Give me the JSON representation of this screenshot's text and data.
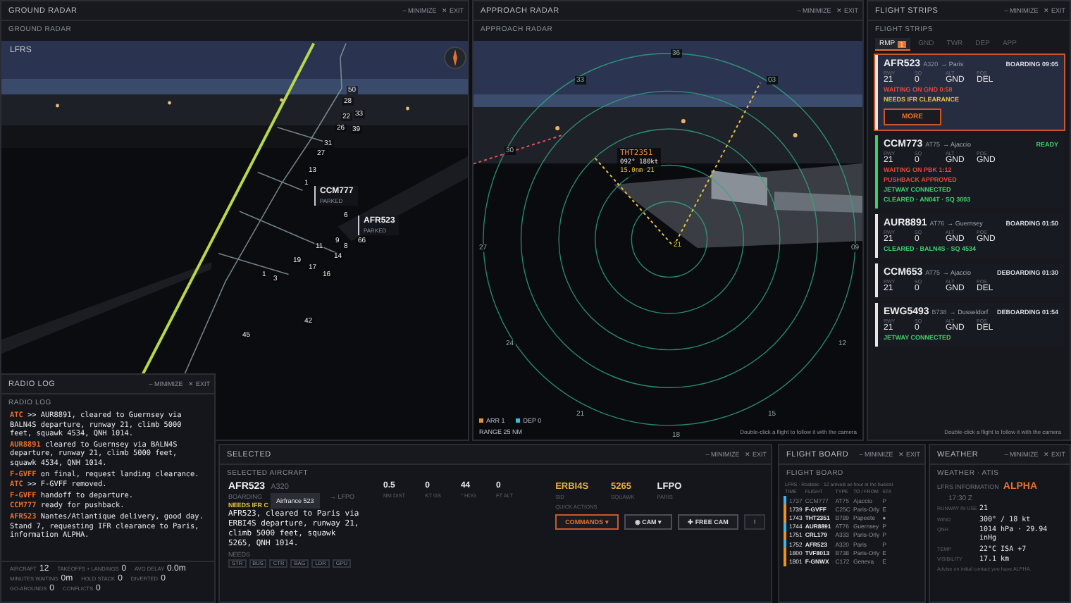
{
  "ground_radar": {
    "title": "GROUND RADAR",
    "minimize": "– MINIMIZE",
    "exit": "✕ EXIT",
    "subtitle": "GROUND RADAR",
    "airport": "LFRS",
    "tags": [
      {
        "callsign": "CCM777",
        "status": "PARKED"
      },
      {
        "callsign": "AFR523",
        "status": "PARKED"
      }
    ],
    "stands": [
      "50",
      "28",
      "22",
      "33",
      "26",
      "39",
      "31",
      "27",
      "13",
      "1",
      "6",
      "9",
      "8",
      "66",
      "11",
      "14",
      "19",
      "17",
      "16",
      "1",
      "3",
      "42",
      "45"
    ]
  },
  "approach_radar": {
    "title": "APPROACH RADAR",
    "minimize": "– MINIMIZE",
    "exit": "✕ EXIT",
    "subtitle": "APPROACH RADAR",
    "bearings": [
      "36",
      "33",
      "03",
      "30",
      "27",
      "09",
      "24",
      "12",
      "21",
      "15",
      "18"
    ],
    "runway": "21",
    "target": {
      "callsign": "THT2351",
      "data": "092° 180kt",
      "route": "15.0nm 21"
    },
    "legend": [
      {
        "label": "ARR 1",
        "color": "#f0902a"
      },
      {
        "label": "DEP 0",
        "color": "#3fb8e8"
      }
    ],
    "range": "RANGE 25 NM",
    "hint": "Double-click a flight to follow it with the camera"
  },
  "flight_strips": {
    "title": "FLIGHT STRIPS",
    "minimize": "– MINIMIZE",
    "exit": "✕ EXIT",
    "subtitle": "FLIGHT STRIPS",
    "tabs": [
      {
        "label": "RMP",
        "badge": "1",
        "selected": true
      },
      {
        "label": "GND",
        "selected": false
      },
      {
        "label": "TWR",
        "selected": false
      },
      {
        "label": "DEP",
        "selected": false
      },
      {
        "label": "APP",
        "selected": false
      }
    ],
    "strips": [
      {
        "callsign": "AFR523",
        "type": "A320",
        "dest": "→ Paris",
        "status": "BOARDING 09:05",
        "columns": [
          "RWY",
          "SQ",
          "ALT",
          "POS"
        ],
        "values": [
          "21",
          "0",
          "GND",
          "DEL"
        ],
        "selected": true,
        "color": "#e8e8e8",
        "notes": [
          {
            "text": "WAITING ON GND 0:58",
            "color": "#e8443a"
          },
          {
            "text": "NEEDS IFR CLEARANCE",
            "color": "#e8c24a"
          }
        ],
        "button": "MORE"
      },
      {
        "callsign": "CCM773",
        "type": "AT75",
        "dest": "→ Ajaccio",
        "status": "READY",
        "columns": [
          "RWY",
          "SQ",
          "ALT",
          "POS"
        ],
        "values": [
          "21",
          "0",
          "GND",
          "GND"
        ],
        "selected": false,
        "color": "#3fcf6a",
        "notes": [
          {
            "text": "WAITING ON PBK 1:12",
            "color": "#e8443a"
          },
          {
            "text": "PUSHBACK APPROVED",
            "color": "#e8443a"
          },
          {
            "text": "JETWAY CONNECTED",
            "color": "#3fcf6a"
          },
          {
            "text": "CLEARED · AN04T · SQ 3003",
            "color": "#3fcf6a"
          }
        ]
      },
      {
        "callsign": "AUR8891",
        "type": "AT76",
        "dest": "→ Guernsey",
        "status": "BOARDING 01:50",
        "columns": [
          "RWY",
          "SQ",
          "ALT",
          "POS"
        ],
        "values": [
          "21",
          "0",
          "GND",
          "GND"
        ],
        "selected": false,
        "color": "#e8e8e8",
        "notes": [
          {
            "text": "CLEARED · BALN4S · SQ 4534",
            "color": "#3fcf6a"
          }
        ]
      },
      {
        "callsign": "CCM653",
        "type": "AT75",
        "dest": "→ Ajaccio",
        "status": "DEBOARDING 01:30",
        "columns": [
          "RWY",
          "SQ",
          "ALT",
          "POS"
        ],
        "values": [
          "21",
          "0",
          "GND",
          "DEL"
        ],
        "selected": false,
        "color": "#e8e8e8"
      },
      {
        "callsign": "EWG5493",
        "type": "B738",
        "dest": "→ Dusseldorf",
        "status": "DEBOARDING 01:54",
        "columns": [
          "RWY",
          "SQ",
          "ALT",
          "POS"
        ],
        "values": [
          "21",
          "0",
          "GND",
          "DEL"
        ],
        "selected": false,
        "color": "#e8e8e8",
        "notes": [
          {
            "text": "JETWAY CONNECTED",
            "color": "#3fcf6a"
          }
        ]
      }
    ],
    "hint": "Double-click a flight to follow it with the camera"
  },
  "radio_log": {
    "title": "RADIO LOG",
    "minimize": "– MINIMIZE",
    "exit": "✕ EXIT",
    "subtitle": "RADIO LOG",
    "entries": [
      {
        "speaker": "ATC",
        "text": ">> AUR8891, cleared to Guernsey via BALN4S departure, runway 21, climb 5000 feet, squawk 4534, QNH 1014."
      },
      {
        "speaker": "AUR8891",
        "text": "cleared to Guernsey via BALN4S departure, runway 21, climb 5000 feet, squawk 4534, QNH 1014."
      },
      {
        "speaker": "F-GVFF",
        "text": "on final, request landing clearance."
      },
      {
        "speaker": "ATC",
        "text": ">> F-GVFF removed."
      },
      {
        "speaker": "F-GVFF",
        "text": "handoff to departure."
      },
      {
        "speaker": "CCM777",
        "text": "ready for pushback."
      },
      {
        "speaker": "AFR523",
        "text": "Nantes/Atlantique delivery, good day. Stand 7, requesting IFR clearance to Paris, information ALPHA."
      }
    ],
    "stats": [
      {
        "label": "AIRCRAFT",
        "value": "12"
      },
      {
        "label": "TAKEOFFS + LANDINGS",
        "value": "0"
      },
      {
        "label": "AVG DELAY",
        "value": "0.0m"
      },
      {
        "label": "MINUTES WAITING",
        "value": "0m"
      },
      {
        "label": "HOLD STACK",
        "value": "0"
      },
      {
        "label": "DIVERTED",
        "value": "0"
      },
      {
        "label": "GO-AROUNDS",
        "value": "0"
      },
      {
        "label": "CONFLICTS",
        "value": "0"
      }
    ]
  },
  "selected": {
    "title": "SELECTED",
    "minimize": "– MINIMIZE",
    "exit": "✕ EXIT",
    "subtitle": "SELECTED AIRCRAFT",
    "callsign": "AFR523",
    "type": "A320",
    "tooltip": "Airfrance 523",
    "phase": "BOARDING",
    "dest": "→ LFPO",
    "alert": "NEEDS IFR C",
    "metrics": [
      {
        "value": "0.5",
        "label": "NM DIST"
      },
      {
        "value": "0",
        "label": "KT GS"
      },
      {
        "value": "44",
        "label": "° HDG"
      },
      {
        "value": "0",
        "label": "FT ALT"
      }
    ],
    "clearance": "AFR523, cleared to Paris via ERBI4S departure, runway 21, climb 5000 feet, squawk 5265, QNH 1014.",
    "needs_label": "NEEDS",
    "needs": [
      "STR",
      "BUS",
      "CTR",
      "BAG",
      "LDR",
      "GPU"
    ],
    "codes": [
      {
        "value": "ERBI4S",
        "label": "SID",
        "highlight": true
      },
      {
        "value": "5265",
        "label": "SQUAWK",
        "highlight": true
      },
      {
        "value": "LFPO",
        "label": "PARIS",
        "highlight": false
      }
    ],
    "actions_label": "QUICK ACTIONS",
    "actions": [
      {
        "label": "COMMANDS ▾",
        "kind": "primary"
      },
      {
        "label": "◉ CAM ▾",
        "kind": "normal"
      },
      {
        "label": "✚ FREE CAM",
        "kind": "normal"
      },
      {
        "label": "!",
        "kind": "muted"
      }
    ]
  },
  "flight_board": {
    "title": "FLIGHT BOARD",
    "minimize": "– MINIMIZE",
    "exit": "✕ EXIT",
    "subtitle": "FLIGHT BOARD",
    "note": "LFRS · Realistic · 12 arrivals an hour at the busiest",
    "columns": [
      "TIME",
      "FLIGHT",
      "TYPE",
      "TO / FROM",
      "STA"
    ],
    "rows": [
      {
        "time": "1737",
        "flight": "CCM777",
        "type": "AT75",
        "place": "Ajaccio",
        "status": "P",
        "color": "#3fb8e8",
        "past": true
      },
      {
        "time": "1739",
        "flight": "F-GVFF",
        "type": "C25C",
        "place": "Paris-Orly",
        "status": "E",
        "color": "#f0902a",
        "past": false
      },
      {
        "time": "1743",
        "flight": "THT2351",
        "type": "B789",
        "place": "Papeete",
        "status": "●",
        "color": "#f0902a",
        "past": false
      },
      {
        "time": "1744",
        "flight": "AUR8891",
        "type": "AT76",
        "place": "Guernsey",
        "status": "P",
        "color": "#3fb8e8",
        "past": false
      },
      {
        "time": "1751",
        "flight": "CRL179",
        "type": "A333",
        "place": "Paris-Orly",
        "status": "P",
        "color": "#f0902a",
        "past": false
      },
      {
        "time": "1752",
        "flight": "AFR523",
        "type": "A320",
        "place": "Paris",
        "status": "P",
        "color": "#3fb8e8",
        "past": false
      },
      {
        "time": "1800",
        "flight": "TVF8013",
        "type": "B738",
        "place": "Paris-Orly",
        "status": "E",
        "color": "#f0902a",
        "past": false
      },
      {
        "time": "1801",
        "flight": "F-GNWX",
        "type": "C172",
        "place": "Geneva",
        "status": "E",
        "color": "#f0902a",
        "past": false
      }
    ]
  },
  "weather": {
    "title": "WEATHER",
    "minimize": "– MINIMIZE",
    "exit": "✕ EXIT",
    "subtitle": "WEATHER · ATIS",
    "heading": "LFRS INFORMATION",
    "letter": "ALPHA",
    "time": "17:30 Z",
    "rows": [
      {
        "label": "RUNWAY IN USE",
        "value": "21"
      },
      {
        "label": "WIND",
        "value": "300° / 18 kt"
      },
      {
        "label": "QNH",
        "value": "1014 hPa · 29.94 inHg"
      },
      {
        "label": "TEMP",
        "value": "22°C  ISA +7"
      },
      {
        "label": "VISIBILITY",
        "value": "17.1 km"
      }
    ],
    "advice": "Advise on initial contact you have ALPHA."
  }
}
